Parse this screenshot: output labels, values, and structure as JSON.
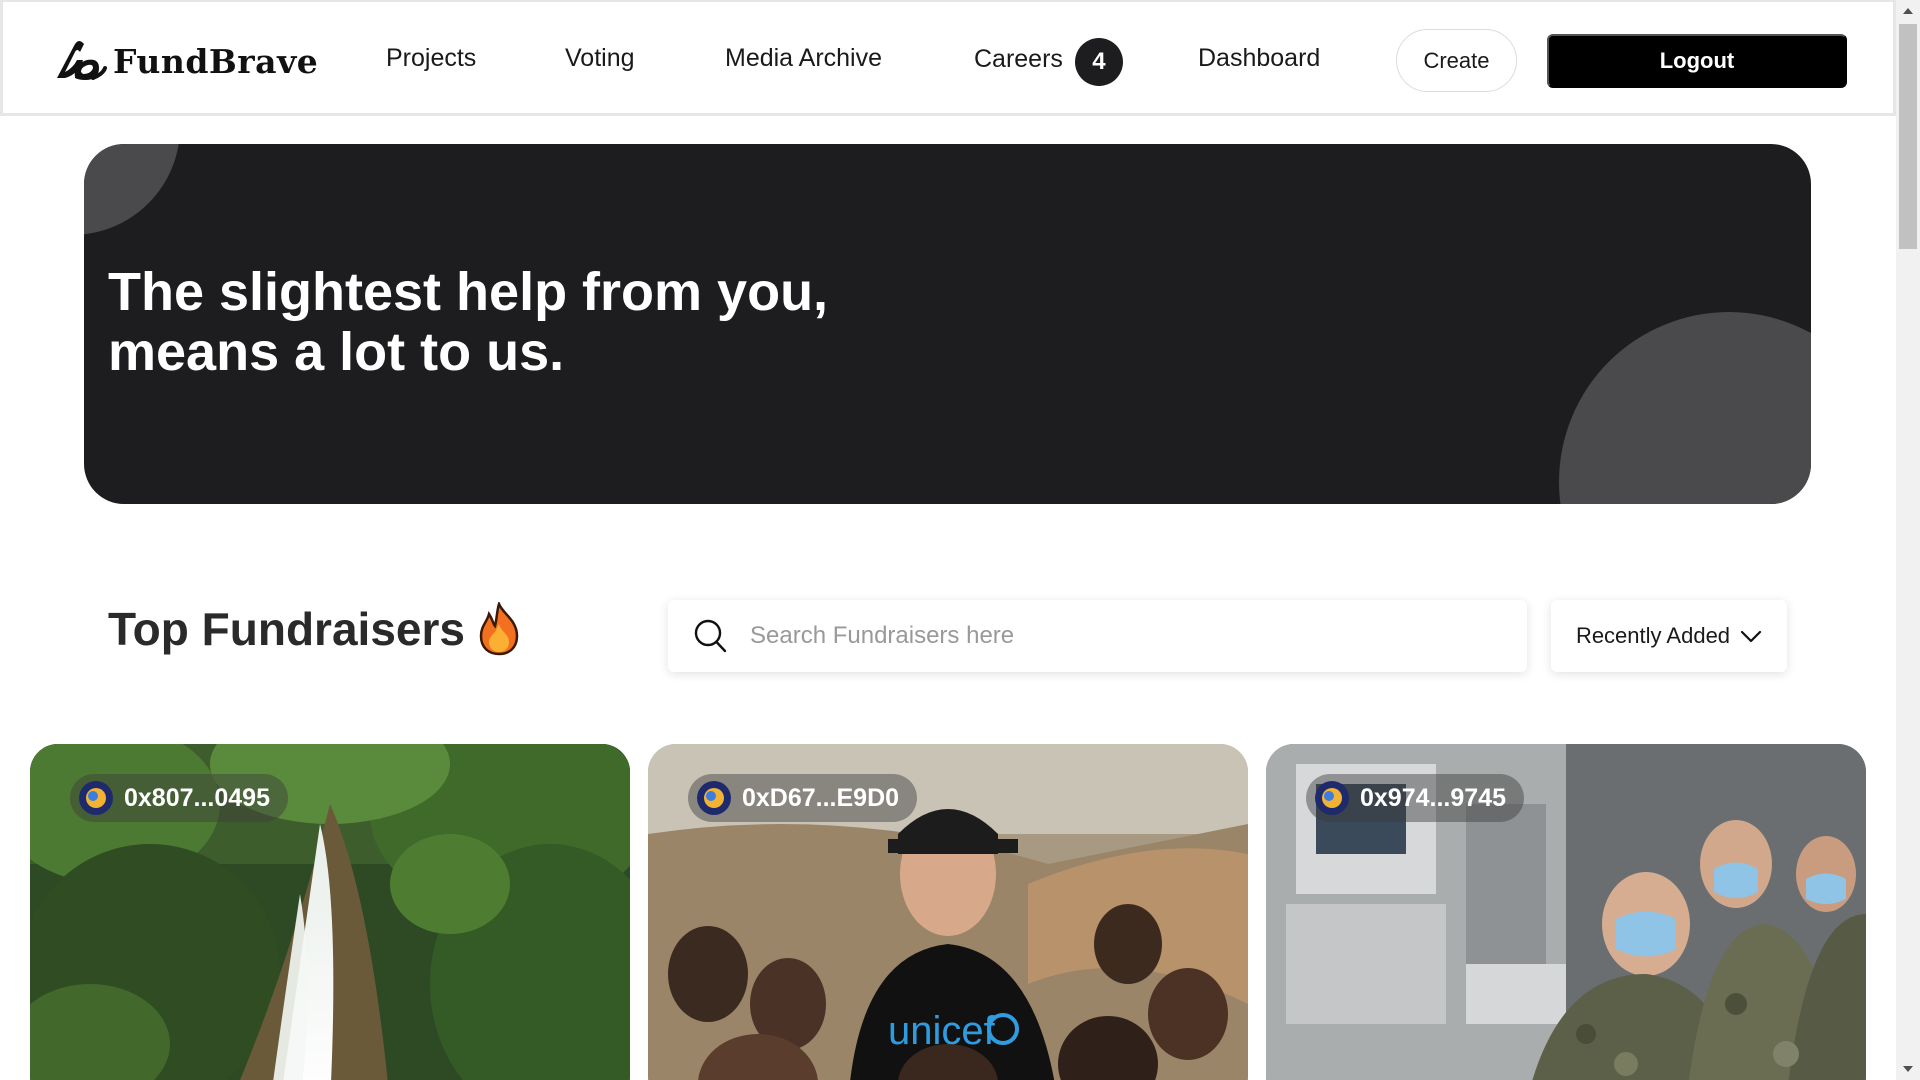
{
  "navbar": {
    "brand": "FundBrave",
    "links": {
      "projects": "Projects",
      "voting": "Voting",
      "media_archive": "Media Archive",
      "careers": "Careers",
      "dashboard": "Dashboard"
    },
    "careers_badge": "4",
    "create_label": "Create",
    "logout_label": "Logout"
  },
  "hero": {
    "line1": "The slightest help from you,",
    "line2": "means a lot to us."
  },
  "fundraisers": {
    "title": "Top Fundraisers",
    "title_icon": "fire-icon",
    "search": {
      "placeholder": "Search Fundraisers here",
      "value": ""
    },
    "sort": {
      "selected": "Recently Added"
    },
    "cards": [
      {
        "owner": "0x807...0495",
        "image": "waterfall-photo"
      },
      {
        "owner": "0xD67...E9D0",
        "image": "unicef-children-photo"
      },
      {
        "owner": "0x974...9745",
        "image": "medical-team-photo"
      }
    ]
  },
  "colors": {
    "hero_bg": "#1d1d1f",
    "hero_circle": "#4a4a4c",
    "logout_bg": "#000000",
    "badge_bg": "#1d1d1f"
  }
}
